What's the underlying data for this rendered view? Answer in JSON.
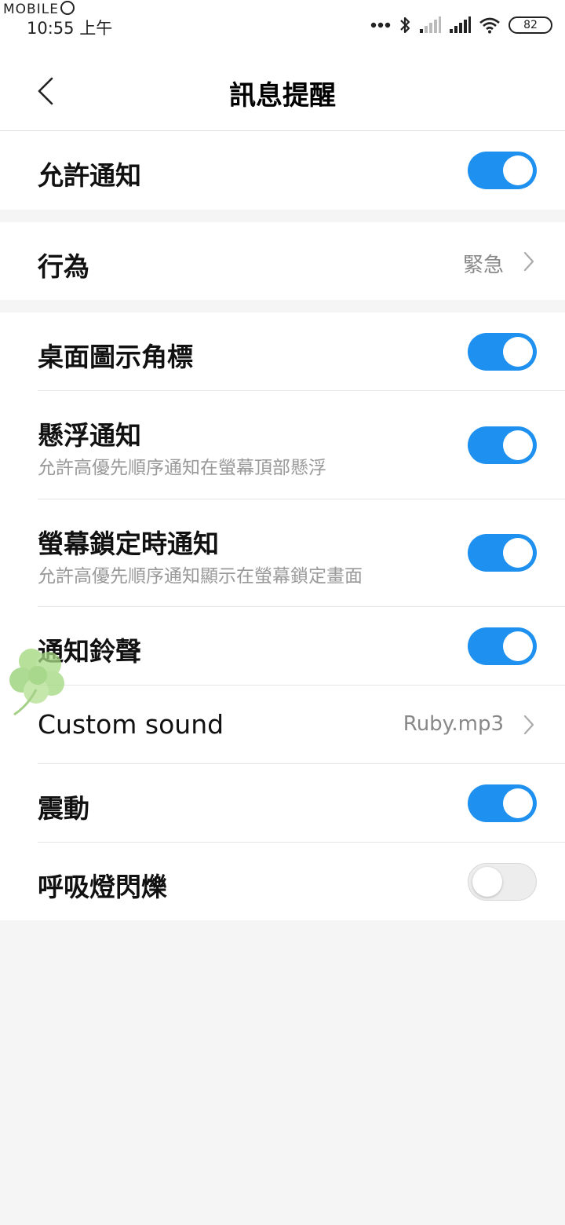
{
  "status_bar": {
    "watermark": "MOBILE",
    "time": "10:55 上午",
    "battery": "82"
  },
  "header": {
    "title": "訊息提醒"
  },
  "settings": {
    "allow_notifications": {
      "label": "允許通知",
      "enabled": true
    },
    "behavior": {
      "label": "行為",
      "value": "緊急"
    },
    "badge": {
      "label": "桌面圖示角標",
      "enabled": true
    },
    "floating": {
      "label": "懸浮通知",
      "description": "允許高優先順序通知在螢幕頂部懸浮",
      "enabled": true
    },
    "lockscreen": {
      "label": "螢幕鎖定時通知",
      "description": "允許高優先順序通知顯示在螢幕鎖定畫面",
      "enabled": true
    },
    "ringtone": {
      "label": "通知鈴聲",
      "enabled": true
    },
    "custom_sound": {
      "label": "Custom sound",
      "value": "Ruby.mp3"
    },
    "vibration": {
      "label": "震動",
      "enabled": true
    },
    "breathing_light": {
      "label": "呼吸燈閃爍",
      "enabled": false
    }
  },
  "colors": {
    "toggle_on": "#1e90f0",
    "toggle_off": "#ededed",
    "secondary_text": "#999999",
    "page_background": "#f5f5f5"
  }
}
